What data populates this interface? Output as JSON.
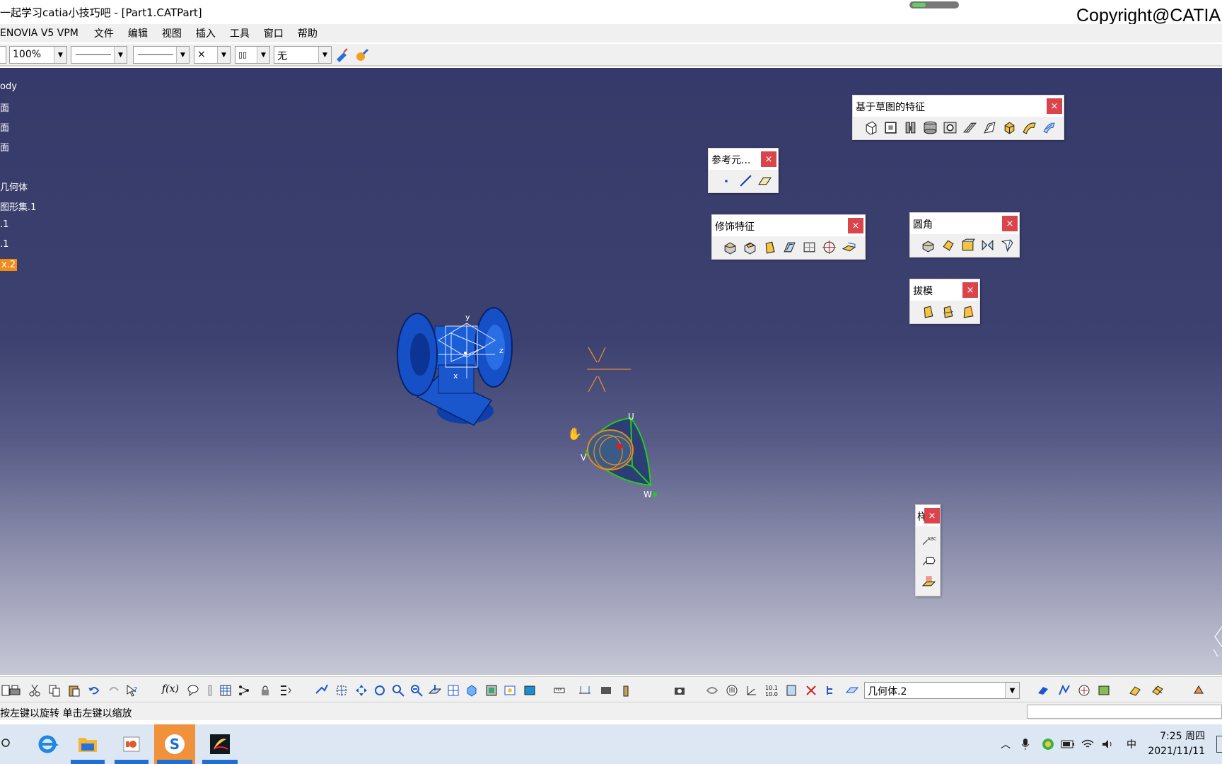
{
  "window": {
    "title": "一起学习catia小技巧吧 - [Part1.CATPart]",
    "copyright": "Copyright@CATIA",
    "title_progress_percent": 30
  },
  "menu": [
    "ENOVIA V5 VPM",
    "文件",
    "编辑",
    "视图",
    "插入",
    "工具",
    "窗口",
    "帮助"
  ],
  "properties_toolbar": {
    "zoom": "100%",
    "weight_selector": "×",
    "layer_value": "无"
  },
  "tree": [
    "ody",
    "面",
    "面",
    "面",
    "几何体",
    "图形集.1",
    ".1",
    ".1",
    "x.2"
  ],
  "tree_selected_index": 8,
  "viewport": {
    "axis_labels": {
      "x": "x",
      "y": "y",
      "z": "z"
    },
    "compass_labels": {
      "u": "U",
      "v": "V",
      "w": "W"
    }
  },
  "toolbars": {
    "sketch_features": {
      "title": "基于草图的特征",
      "close": "×"
    },
    "reference_elements": {
      "title": "参考元...",
      "close": "×"
    },
    "dress_up": {
      "title": "修饰特征",
      "close": "×"
    },
    "fillets": {
      "title": "圆角",
      "close": "×"
    },
    "draft": {
      "title": "拔模",
      "close": "×"
    },
    "vertical": {
      "title": "样",
      "close": "×"
    }
  },
  "bottom_toolbar": {
    "current_body": "几何体.2",
    "formula_label": "f(x)"
  },
  "status": {
    "message": "按左键以旋转 单击左键以缩放"
  },
  "taskbar": {
    "ime": "中",
    "time": "7:25 周四",
    "date": "2021/11/11"
  },
  "colors": {
    "viewport_top": "#363a6a",
    "selection": "#f08c1a",
    "close_button": "#d9454b",
    "part": "#1650c6",
    "compass": "#22cc22"
  }
}
